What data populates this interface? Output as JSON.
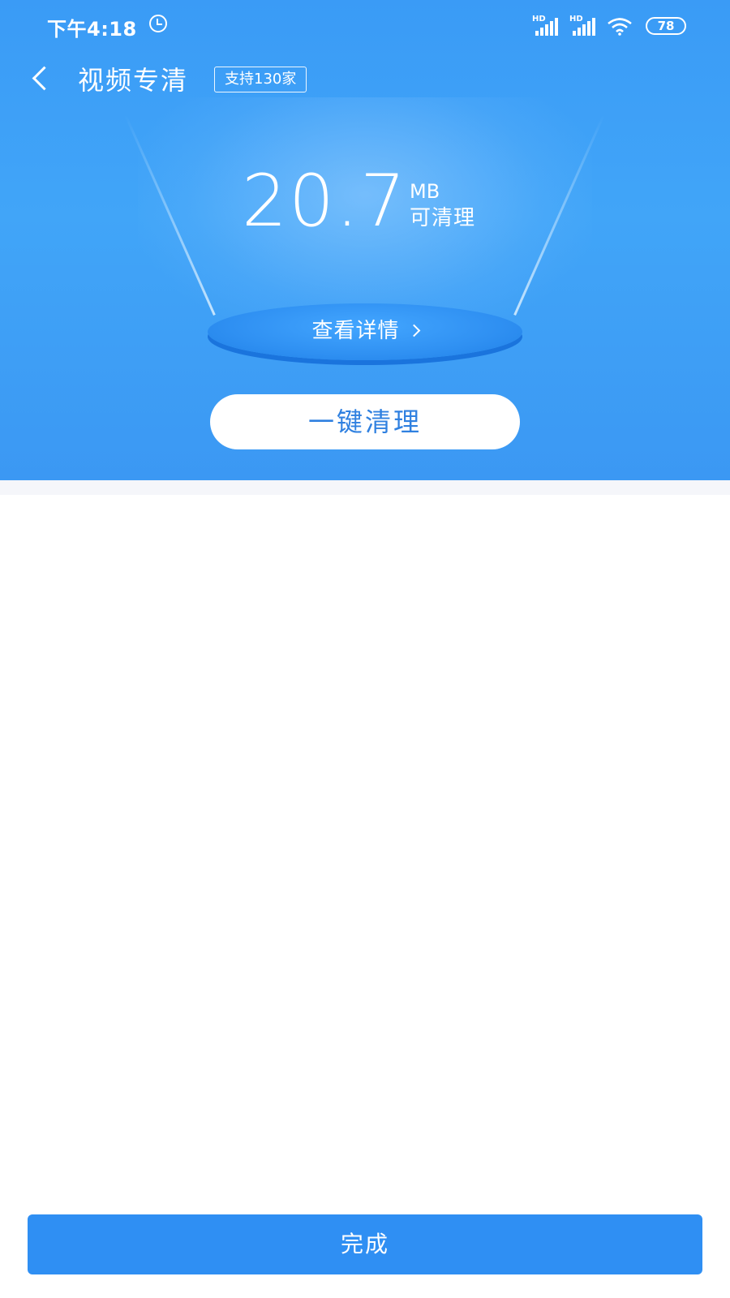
{
  "status_bar": {
    "time": "下午4:18",
    "signal_hd_label": "HD",
    "battery_level": "78"
  },
  "header": {
    "title": "视频专清",
    "support_badge": "支持130家"
  },
  "summary": {
    "size_value": "20.7",
    "size_unit": "MB",
    "size_caption": "可清理"
  },
  "actions": {
    "detail_link": "查看详情",
    "clean_button": "一键清理",
    "done_button": "完成"
  },
  "icons": {
    "back": "chevron-left-icon",
    "detail_arrow": "chevron-right-icon",
    "alarm": "alarm-icon",
    "signal": "signal-icon",
    "wifi": "wifi-icon",
    "battery": "battery-icon"
  },
  "colors": {
    "primary_blue": "#2f8ff3",
    "hero_blue": "#3a9bf6",
    "clean_button_text": "#2f80e0",
    "divider": "#f5f6fa"
  }
}
